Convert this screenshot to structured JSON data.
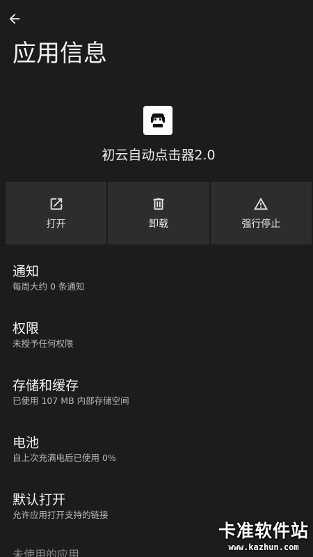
{
  "header": {
    "back_icon": "arrow-back-icon",
    "title": "应用信息"
  },
  "app": {
    "icon": "app-logo-icon",
    "name": "初云自动点击器2.0"
  },
  "actions": [
    {
      "label": "打开",
      "icon": "open-external-icon"
    },
    {
      "label": "卸载",
      "icon": "trash-icon"
    },
    {
      "label": "强行停止",
      "icon": "warning-icon"
    }
  ],
  "settings": [
    {
      "title": "通知",
      "summary": "每周大约 0 条通知"
    },
    {
      "title": "权限",
      "summary": "未授予任何权限"
    },
    {
      "title": "存储和缓存",
      "summary": "已使用 107 MB 内部存储空间"
    },
    {
      "title": "电池",
      "summary": "自上次充满电后已使用 0%"
    },
    {
      "title": "默认打开",
      "summary": "允许应用打开支持的链接"
    }
  ],
  "partial_item": "未使用的应用",
  "watermark": {
    "title": "卡准软件站",
    "url": "www.kazhun.com"
  },
  "colors": {
    "background": "#1c1c1c",
    "card": "#2d2d2d",
    "text": "#ececec",
    "secondary_text": "#b9b9b9"
  }
}
